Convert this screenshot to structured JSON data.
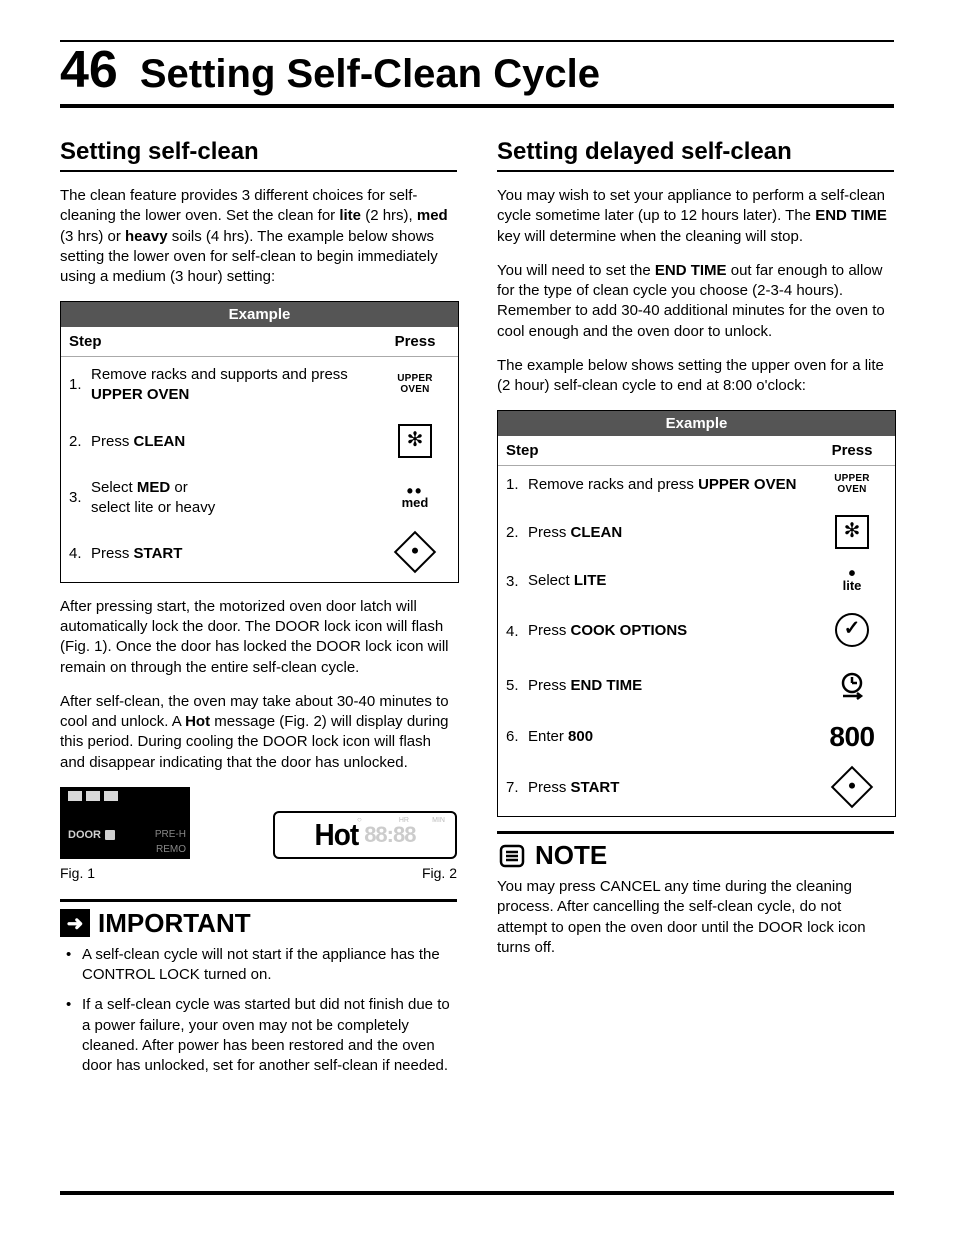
{
  "page_number": "46",
  "page_title": "Setting Self-Clean Cycle",
  "left": {
    "heading": "Setting self-clean",
    "intro_html": "The clean feature provides 3 different choices for self-cleaning the lower oven. Set the clean for <b>lite</b> (2 hrs), <b>med</b> (3 hrs) or <b>heavy</b> soils (4 hrs). The example below shows setting the lower oven for self-clean to begin immediately using a medium (3 hour) setting:",
    "table_title": "Example",
    "col_step": "Step",
    "col_press": "Press",
    "rows": [
      {
        "n": "1.",
        "html": "Remove racks and supports and press <b>UPPER OVEN</b>",
        "icon": "upper-oven"
      },
      {
        "n": "2.",
        "html": "Press <b>CLEAN</b>",
        "icon": "clean-box"
      },
      {
        "n": "3.",
        "html": "Select <b>MED</b> or<br>select lite or heavy",
        "icon": "med"
      },
      {
        "n": "4.",
        "html": "Press <b>START</b>",
        "icon": "start"
      }
    ],
    "after1_html": "After pressing start, the motorized oven door latch will automatically lock the door. The DOOR lock icon will flash (Fig. 1). Once the door has locked the DOOR lock icon will remain on through the entire self-clean cycle.",
    "after2_html": "After self-clean, the oven may take about 30-40 minutes to cool and unlock. A <b>Hot</b> message (Fig. 2) will display during this period. During cooling the DOOR lock icon will flash and disappear indicating that the door has unlocked.",
    "fig1_door": "DOOR",
    "fig1_pre": "PRE-H",
    "fig1_rem": "REMO",
    "fig2_hot": "Hot",
    "fig2_dim": "88:88",
    "fig1_label": "Fig. 1",
    "fig2_label": "Fig. 2",
    "important_title": "IMPORTANT",
    "important_items": [
      "A self-clean cycle will not start if the appliance has the CONTROL LOCK turned on.",
      "If a self-clean cycle was started but did not finish due to a power failure, your oven may not be completely cleaned. After power has been restored and the oven door has unlocked, set for another self-clean if needed."
    ]
  },
  "right": {
    "heading": "Setting delayed self-clean",
    "p1_html": "You may wish to set your appliance to perform a self-clean cycle sometime later (up to 12 hours later). The <b>END TIME</b> key will determine when the cleaning will stop.",
    "p2_html": "You will need to set the <b>END TIME</b> out far enough to allow for the type of clean cycle you choose (2-3-4 hours). Remember to add 30-40 additional minutes for the oven to cool enough and the oven door to unlock.",
    "p3_html": "The example below shows setting the upper oven for a lite (2 hour) self-clean cycle to end at 8:00 o'clock:",
    "table_title": "Example",
    "col_step": "Step",
    "col_press": "Press",
    "rows": [
      {
        "n": "1.",
        "html": "Remove racks and press <b>UPPER OVEN</b>",
        "icon": "upper-oven"
      },
      {
        "n": "2.",
        "html": "Press <b>CLEAN</b>",
        "icon": "clean-box"
      },
      {
        "n": "3.",
        "html": "Select <b>LITE</b>",
        "icon": "lite"
      },
      {
        "n": "4.",
        "html": "Press <b>COOK OPTIONS</b>",
        "icon": "check"
      },
      {
        "n": "5.",
        "html": "Press <b>END TIME</b>",
        "icon": "clock"
      },
      {
        "n": "6.",
        "html": "Enter <b>800</b>",
        "icon": "800"
      },
      {
        "n": "7.",
        "html": "Press <b>START</b>",
        "icon": "start"
      }
    ],
    "note_title": "NOTE",
    "note_body": "You may press CANCEL any time during the cleaning process. After cancelling the self-clean cycle, do not attempt to open the oven door until the DOOR lock icon turns off."
  },
  "icon_labels": {
    "upper": "UPPER",
    "oven": "OVEN",
    "med": "med",
    "lite": "lite",
    "v800": "800"
  }
}
